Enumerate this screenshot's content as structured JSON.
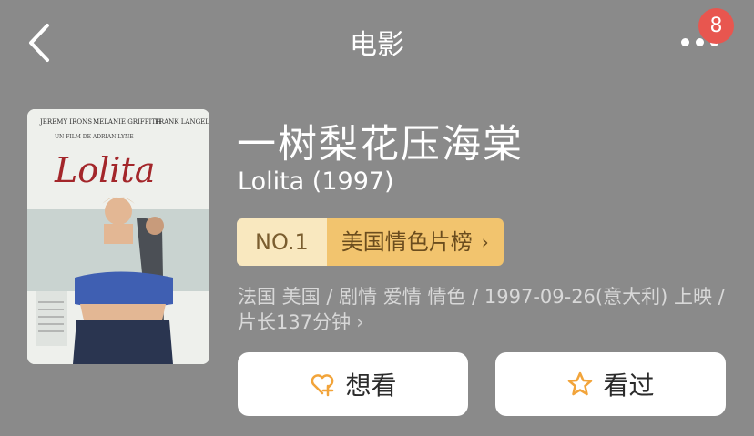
{
  "header": {
    "title": "电影",
    "badge_count": "8"
  },
  "movie": {
    "poster": {
      "cast": [
        "JEREMY IRONS",
        "MELANIE GRIFFITH",
        "FRANK LANGELLA"
      ],
      "director_line": "UN FILM DE ADRIAN LYNE",
      "logo_text": "Lolita"
    },
    "title_cn": "一树梨花压海棠",
    "title_en": "Lolita (1997)",
    "rank": {
      "number": "NO.1",
      "list_name": "美国情色片榜"
    },
    "meta_line": "法国 美国 / 剧情 爱情 情色 / 1997-09-26(意大利) 上映 / 片长137分钟"
  },
  "actions": {
    "want_label": "想看",
    "seen_label": "看过"
  },
  "colors": {
    "background": "#8a8a8a",
    "badge": "#e8564f",
    "rank_light": "#f9e8bf",
    "rank_dark": "#f2c46e",
    "icon_accent": "#f2a43a"
  }
}
